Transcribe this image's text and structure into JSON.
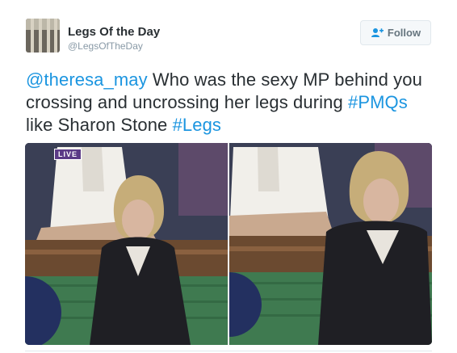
{
  "user": {
    "name": "Legs Of the Day",
    "handle": "@LegsOfTheDay"
  },
  "follow_button": {
    "label": "Follow",
    "icon": "add-user-icon"
  },
  "tweet": {
    "mention": "@theresa_may",
    "text_part1": " Who was the sexy MP behind you crossing and uncrossing her legs during ",
    "hashtag1": "#PMQs",
    "text_part2": " like Sharon Stone ",
    "hashtag2": "#Legs"
  },
  "media": {
    "badge": "LIVE"
  },
  "colors": {
    "link": "#1b95e0",
    "text": "#292f33",
    "secondary": "#8899a6",
    "live_badge": "#5b3a86"
  }
}
